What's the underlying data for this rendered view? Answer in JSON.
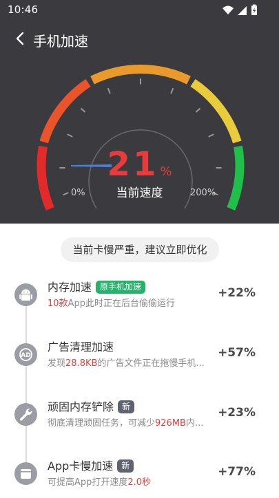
{
  "status_bar": {
    "time": "10:46"
  },
  "header": {
    "title": "手机加速"
  },
  "gauge": {
    "value": "21",
    "unit": "%",
    "label": "当前速度",
    "min_label": "0%",
    "max_label": "200%",
    "needle_fraction": 0.105,
    "colors": {
      "red": "#e32a2a",
      "orange_red": "#e9542a",
      "orange": "#ea9a2c",
      "yellow": "#e9cc3b",
      "green": "#1fbf4a"
    }
  },
  "warning": "当前卡慢严重，建议立即优化",
  "items": [
    {
      "icon": "android-icon",
      "title": "内存加速",
      "badge": "原手机加速",
      "badge_style": "green",
      "desc_hl": "10款",
      "desc_rest": "App此时正在后台偷偷运行",
      "desc_pre": "",
      "gain": "+22%"
    },
    {
      "icon": "ad-icon",
      "title": "广告清理加速",
      "badge": "",
      "badge_style": "",
      "desc_pre": "发现",
      "desc_hl": "28.8KB",
      "desc_rest": "的广告文件正在拖慢手机...",
      "gain": "+57%"
    },
    {
      "icon": "wrench-icon",
      "title": "顽固内存铲除",
      "badge": "新",
      "badge_style": "gray",
      "desc_pre": "彻底清理顽固任务，可减少",
      "desc_hl": "926MB",
      "desc_rest": "内...",
      "gain": "+23%"
    },
    {
      "icon": "app-window-icon",
      "title": "App卡慢加速",
      "badge": "新",
      "badge_style": "gray",
      "desc_pre": "可提高App打开速度",
      "desc_hl": "2.0秒",
      "desc_rest": "",
      "gain": "+77%"
    }
  ]
}
